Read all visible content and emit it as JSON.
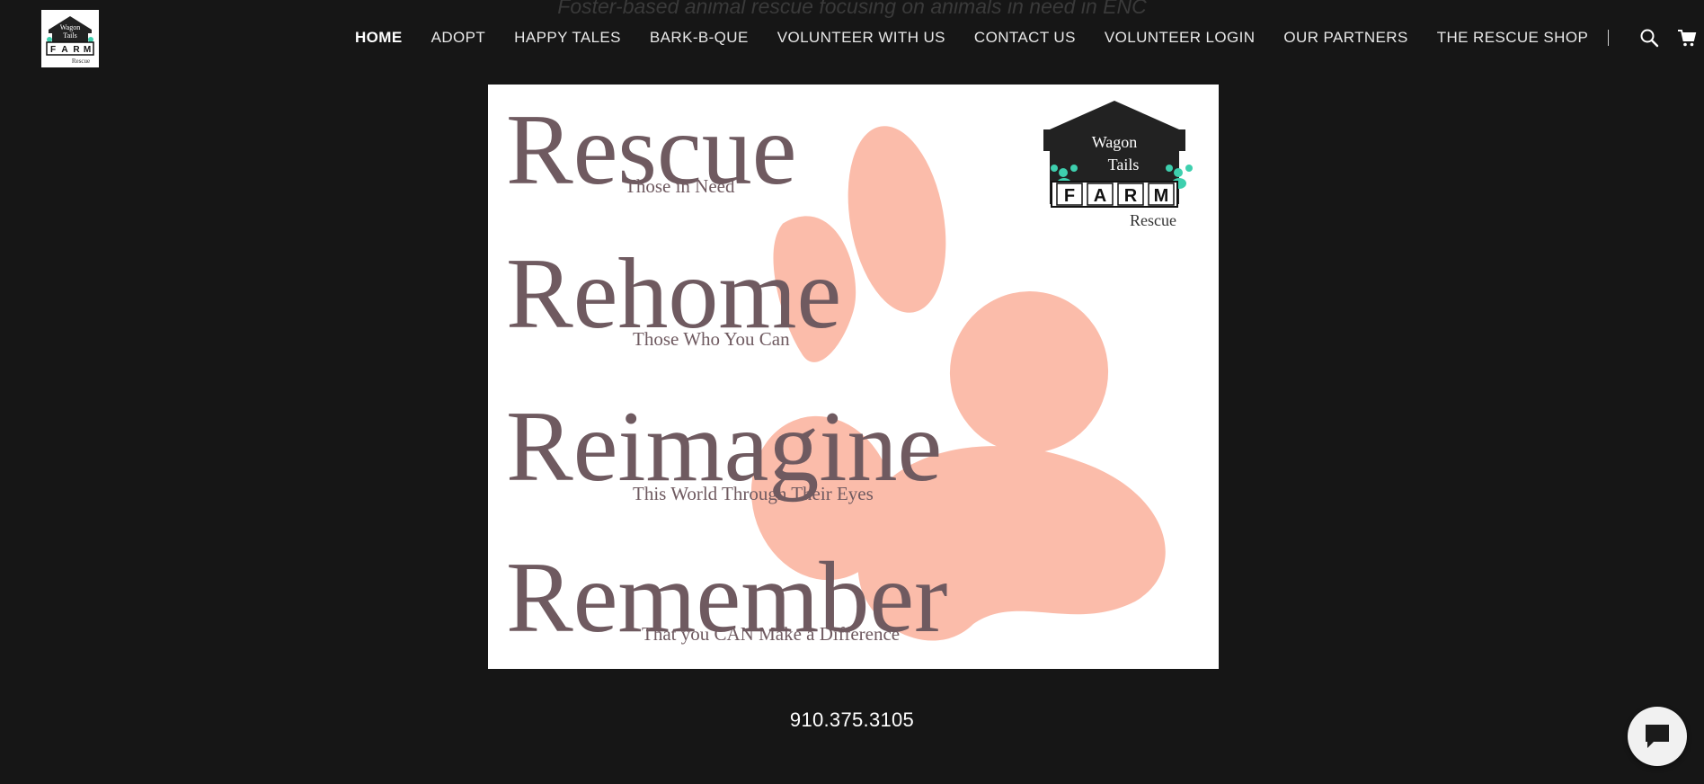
{
  "tagline": "Foster-based animal rescue focusing on animals in need in ENC",
  "logo": {
    "line1": "Wagon",
    "line2": "Tails",
    "letters": [
      "F",
      "A",
      "R",
      "M"
    ],
    "line3": "Rescue"
  },
  "nav": {
    "items": [
      {
        "label": "HOME",
        "active": true
      },
      {
        "label": "ADOPT"
      },
      {
        "label": "HAPPY TALES"
      },
      {
        "label": "BARK-B-QUE"
      },
      {
        "label": "VOLUNTEER WITH US"
      },
      {
        "label": "CONTACT US"
      },
      {
        "label": "VOLUNTEER LOGIN"
      },
      {
        "label": "OUR PARTNERS"
      },
      {
        "label": "THE RESCUE SHOP"
      }
    ],
    "icons": [
      "search-icon",
      "cart-icon",
      "account-icon"
    ]
  },
  "hero": {
    "rows": [
      {
        "word": "Rescue",
        "sub": "Those in Need"
      },
      {
        "word": "Rehome",
        "sub": "Those Who You Can"
      },
      {
        "word": "Reimagine",
        "sub": "This World Through Their Eyes"
      },
      {
        "word": "Remember",
        "sub": "That you CAN Make a Difference"
      }
    ],
    "badge": {
      "line1": "Wagon",
      "line2": "Tails",
      "letters": [
        "F",
        "A",
        "R",
        "M"
      ],
      "line3": "Rescue"
    },
    "colors": {
      "text": "#6f5a60",
      "paw": "#fbbcaa",
      "badge": "#222222",
      "accent": "#3ecfae"
    }
  },
  "phone": "910.375.3105",
  "colors": {
    "background": "#161616"
  }
}
